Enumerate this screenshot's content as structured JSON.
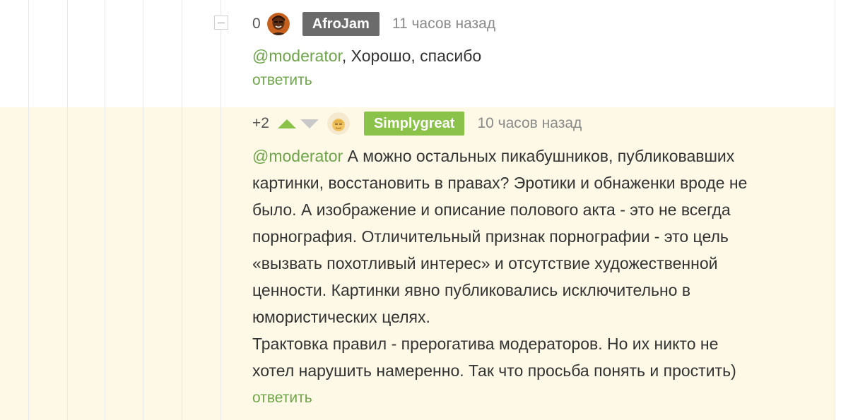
{
  "comments": [
    {
      "rating": "0",
      "author": "AfroJam",
      "time": "11 часов назад",
      "mention": "@moderator",
      "text": ", Хорошо, спасибо",
      "reply": "ответить"
    },
    {
      "rating": "+2",
      "author": "Simplygreat",
      "time": "10 часов назад",
      "mention": "@moderator",
      "lines": [
        "А можно остальных пикабушников, публиковавших",
        "картинки, восстановить в правах? Эротики и обнаженки вроде не",
        "было. А изображение и описание полового акта - это не всегда",
        "порнография. Отличительный признак порнографии - это цель",
        "«вызвать похотливый интерес» и отсутствие художественной",
        "ценности. Картинки явно публиковались исключительно в",
        "юмористических целях.",
        "Трактовка правил - прерогатива модераторов. Но их никто не",
        "хотел нарушить намеренно. Так что просьба понять и простить)"
      ],
      "reply": "ответить"
    }
  ],
  "icons": {
    "collapse": "minus-square-icon",
    "vote_up": "arrow-up-icon",
    "vote_down": "arrow-down-icon"
  },
  "colors": {
    "accent_green": "#6ea54a",
    "upvote_green": "#8bc34a",
    "nick_afrojam_bg": "#6b6b6b",
    "nick_simplygreat_bg": "#8bc34a",
    "highlight_bg": "#fdf9e6"
  }
}
